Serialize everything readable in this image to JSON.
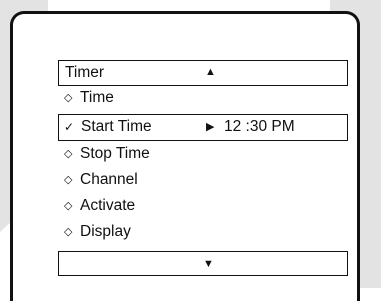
{
  "menu": {
    "title": "Timer",
    "scroll_up_glyph": "▲",
    "scroll_down_glyph": "▼",
    "items": [
      {
        "bullet": "◇",
        "label": "Time"
      },
      {
        "bullet": "✓",
        "label": "Start Time",
        "arrow": "▶",
        "value": "12 :30 PM"
      },
      {
        "bullet": "◇",
        "label": "Stop Time"
      },
      {
        "bullet": "◇",
        "label": "Channel"
      },
      {
        "bullet": "◇",
        "label": "Activate"
      },
      {
        "bullet": "◇",
        "label": "Display"
      }
    ]
  },
  "colors": {
    "background_panel": "#e3e3e3",
    "frame_border": "#111111",
    "text": "#111111"
  }
}
